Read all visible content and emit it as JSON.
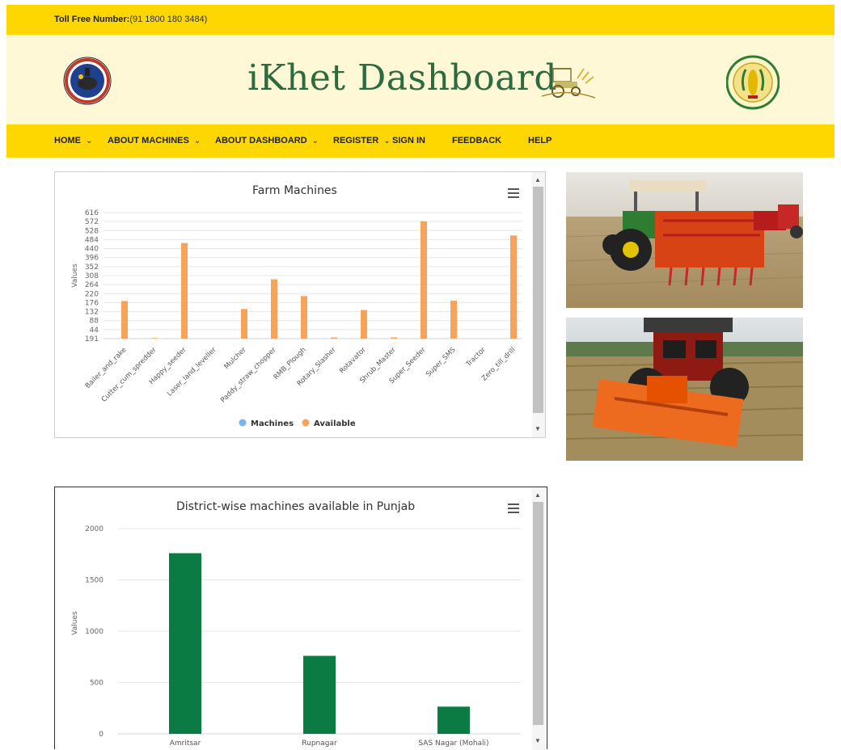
{
  "topbar": {
    "toll_label": "Toll Free Number:",
    "toll_value": "(91 1800 180 3484)"
  },
  "header": {
    "title": "iKhet Dashboard",
    "left_logo_icon": "remote-sensing-centre-emblem",
    "right_logo_icon": "department-of-agriculture-emblem",
    "title_art_icon": "tractor-farm-illustration"
  },
  "nav": {
    "items": [
      {
        "label": "HOME",
        "dropdown": true
      },
      {
        "label": "ABOUT MACHINES",
        "dropdown": true
      },
      {
        "label": "ABOUT DASHBOARD",
        "dropdown": true
      },
      {
        "label": "REGISTER",
        "dropdown": true
      },
      {
        "label": "SIGN IN",
        "dropdown": false
      },
      {
        "label": "FEEDBACK",
        "dropdown": false
      },
      {
        "label": "HELP",
        "dropdown": false
      }
    ]
  },
  "chart_data": [
    {
      "type": "bar",
      "title": "Farm Machines",
      "ylabel": "Values",
      "xlabel": "",
      "ytick_labels": [
        "191",
        "44",
        "88",
        "132",
        "176",
        "220",
        "264",
        "308",
        "352",
        "396",
        "440",
        "484",
        "528",
        "572",
        "616"
      ],
      "ytick_values": [
        0,
        44,
        88,
        132,
        176,
        220,
        264,
        308,
        352,
        396,
        440,
        484,
        528,
        572,
        616
      ],
      "ylim": [
        0,
        616
      ],
      "categories": [
        "Bailer_and_rake",
        "Cutter_cum_spredder",
        "Happy_seeder",
        "Laser_land_leveller",
        "Mulcher",
        "Paddy_straw_chopper",
        "RMB_Plough",
        "Rotary_Slasher",
        "Rotavator",
        "Shrub_Master",
        "Super_Seeder",
        "Super_SMS",
        "Tractor",
        "Zero_till_drill"
      ],
      "series": [
        {
          "name": "Machines",
          "color": "#7cb5ec",
          "values": [
            0,
            0,
            0,
            0,
            0,
            0,
            0,
            0,
            0,
            0,
            0,
            0,
            0,
            0
          ]
        },
        {
          "name": "Available",
          "color": "#f7a35c",
          "values": [
            184,
            3,
            467,
            0,
            145,
            290,
            208,
            6,
            140,
            6,
            573,
            185,
            0,
            504
          ]
        }
      ],
      "grid": true,
      "legend": "bottom-center"
    },
    {
      "type": "bar",
      "title": "District-wise machines available in Punjab",
      "ylabel": "Values",
      "xlabel": "",
      "ytick_values": [
        0,
        500,
        1000,
        1500,
        2000
      ],
      "ylim": [
        0,
        2000
      ],
      "categories": [
        "Amritsar",
        "Rupnagar",
        "SAS Nagar (Mohali)"
      ],
      "series": [
        {
          "color": "#0b7a43",
          "values": [
            1760,
            760,
            265
          ]
        }
      ],
      "grid": true,
      "legend": "none"
    }
  ],
  "photos": [
    {
      "icon": "tractor-with-red-seeder-photo"
    },
    {
      "icon": "tractor-with-orange-mulcher-photo"
    }
  ],
  "colors": {
    "accent_yellow": "#ffd700",
    "banner_bg": "#fff8d6",
    "title_green": "#2d6a3f"
  }
}
